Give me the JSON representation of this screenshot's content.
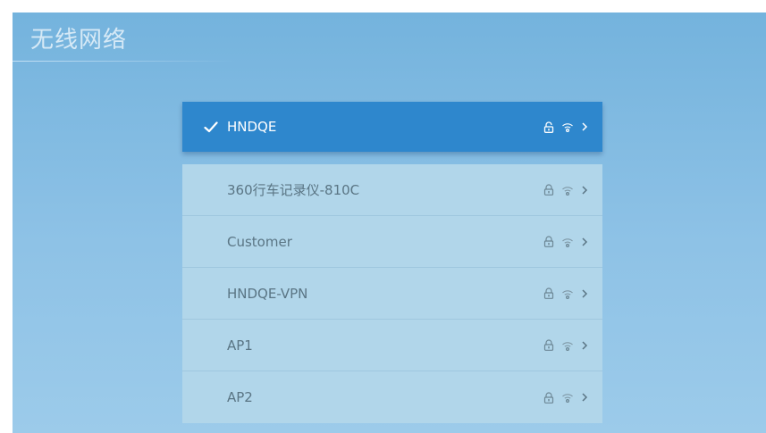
{
  "page": {
    "title": "无线网络"
  },
  "connected_network": {
    "ssid": "HNDQE",
    "status_icon": "check-icon",
    "icons": [
      "lock-icon",
      "wifi-icon",
      "chevron-right-icon"
    ]
  },
  "networks": [
    {
      "ssid": "360行车记录仪-810C",
      "icons": [
        "lock-icon",
        "wifi-icon",
        "chevron-right-icon"
      ]
    },
    {
      "ssid": "Customer",
      "icons": [
        "lock-icon",
        "wifi-icon",
        "chevron-right-icon"
      ]
    },
    {
      "ssid": "HNDQE-VPN",
      "icons": [
        "lock-icon",
        "wifi-icon",
        "chevron-right-icon"
      ]
    },
    {
      "ssid": "AP1",
      "icons": [
        "lock-icon",
        "wifi-icon",
        "chevron-right-icon"
      ]
    },
    {
      "ssid": "AP2",
      "icons": [
        "lock-icon",
        "wifi-icon",
        "chevron-right-icon"
      ]
    }
  ],
  "colors": {
    "background": "#8ec2e6",
    "selected_row": "#2e87cd",
    "list_row": "#b1d6ea",
    "list_text": "#5a7584"
  }
}
